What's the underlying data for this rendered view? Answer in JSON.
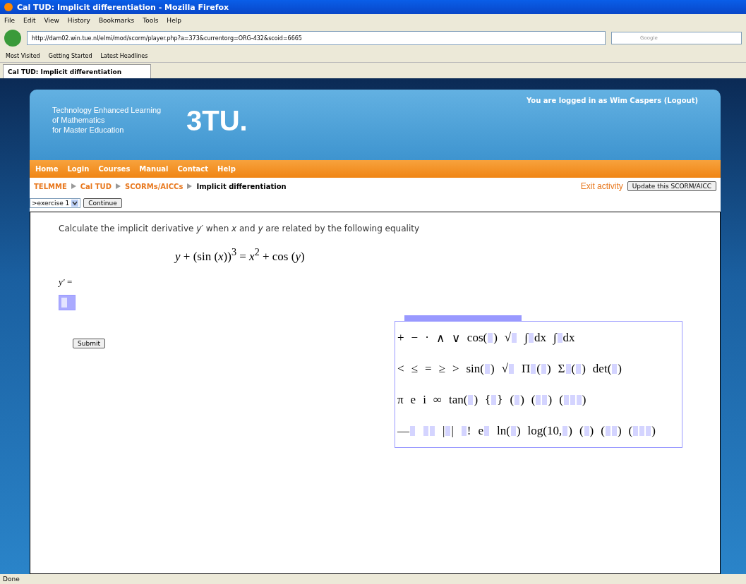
{
  "window": {
    "title": "Cal TUD: Implicit differentiation - Mozilla Firefox"
  },
  "menu": [
    "File",
    "Edit",
    "View",
    "History",
    "Bookmarks",
    "Tools",
    "Help"
  ],
  "address": {
    "value": "http://dam02.win.tue.nl/elmi/mod/scorm/player.php?a=373&currentorg=ORG-432&scoid=6665"
  },
  "search": {
    "placeholder": "Google"
  },
  "bookmarks": [
    "Most Visited",
    "Getting Started",
    "Latest Headlines"
  ],
  "tabs": [
    {
      "label": "Cal TUD: Implicit differentiation",
      "selected": true
    }
  ],
  "header": {
    "tagline": [
      "Technology Enhanced Learning",
      "of Mathematics",
      "for Master Education"
    ],
    "logo": "3TU.",
    "login": "You are logged in as Wim Caspers (Logout)"
  },
  "nav": [
    "Home",
    "Login",
    "Courses",
    "Manual",
    "Contact",
    "Help"
  ],
  "breadcrumb": [
    {
      "label": "TELMME",
      "current": false
    },
    {
      "label": "Cal TUD",
      "current": false
    },
    {
      "label": "SCORMs/AICCs",
      "current": false
    },
    {
      "label": "Implicit differentiation",
      "current": true
    }
  ],
  "exit_link": "Exit activity",
  "update_button": "Update this SCORM/AICC",
  "exercise_select": {
    "value": ">exercise 1"
  },
  "continue_button": "Continue",
  "question": "Calculate the implicit derivative *y′* when *x* and *y* are related by the following equality",
  "equation": "*y* + (sin (*x*))$^{3}$ = *x*$^{2}$ + cos (*y*)",
  "answer_label": "*y′* =",
  "submit_button": "Submit",
  "palette": [
    [
      [
        "+"
      ],
      [
        "−"
      ],
      [
        "·"
      ],
      [
        "∧"
      ],
      [
        "∨"
      ],
      [
        "cos(",
        {
          "kind": "slot"
        },
        ")"
      ],
      [
        "√",
        {
          "kind": "slot"
        }
      ],
      [
        "∫",
        {
          "kind": "slot"
        },
        "dx"
      ],
      [
        "∫",
        {
          "kind": "slot"
        },
        "dx"
      ]
    ],
    [
      [
        "<"
      ],
      [
        "≤"
      ],
      [
        "="
      ],
      [
        "≥"
      ],
      [
        ">"
      ],
      [
        "sin(",
        {
          "kind": "slot"
        },
        ")"
      ],
      [
        "√",
        {
          "kind": "slot"
        }
      ],
      [
        "Π",
        {
          "kind": "slot"
        },
        "(",
        {
          "kind": "slot"
        },
        ")"
      ],
      [
        "Σ",
        {
          "kind": "slot"
        },
        "(",
        {
          "kind": "slot"
        },
        ")"
      ],
      [
        "det(",
        {
          "kind": "slot"
        },
        ")"
      ]
    ],
    [
      [
        "π"
      ],
      [
        "e"
      ],
      [
        "i"
      ],
      [
        "∞"
      ],
      [
        "tan(",
        {
          "kind": "slot"
        },
        ")"
      ],
      [
        "{",
        {
          "kind": "slot"
        },
        "}"
      ],
      [
        "(",
        {
          "kind": "slot"
        },
        ")"
      ],
      [
        "(",
        {
          "kind": "slot"
        },
        {
          "kind": "slot"
        },
        ")"
      ],
      [
        "(",
        {
          "kind": "slot"
        },
        {
          "kind": "slot"
        },
        {
          "kind": "slot"
        },
        ")"
      ]
    ],
    [
      [
        "—",
        {
          "kind": "slot"
        }
      ],
      [
        {
          "kind": "slot"
        },
        {
          "kind": "slot"
        }
      ],
      [
        "|",
        {
          "kind": "slot"
        },
        "|"
      ],
      [
        {
          "kind": "slot"
        },
        "!"
      ],
      [
        "e",
        {
          "kind": "slot"
        }
      ],
      [
        "ln(",
        {
          "kind": "slot"
        },
        ")"
      ],
      [
        "log(10,",
        {
          "kind": "slot"
        },
        ")"
      ],
      [
        "(",
        {
          "kind": "slot"
        },
        ")"
      ],
      [
        "(",
        {
          "kind": "slot"
        },
        {
          "kind": "slot"
        },
        ")"
      ],
      [
        "(",
        {
          "kind": "slot"
        },
        {
          "kind": "slot"
        },
        {
          "kind": "slot"
        },
        ")"
      ]
    ]
  ],
  "status_bar": "Done"
}
